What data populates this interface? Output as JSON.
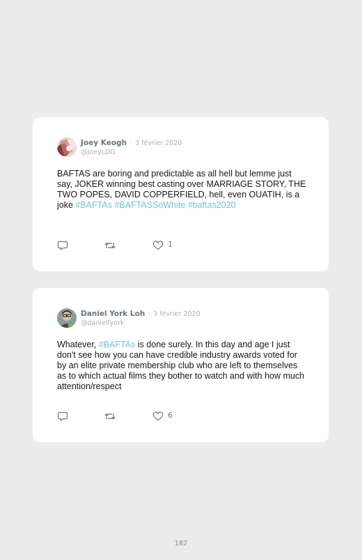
{
  "tweets": [
    {
      "name": "Joey Keogh",
      "separator": "·",
      "date": "3 février 2020",
      "handle": "@JoeyLDG",
      "text_parts": [
        {
          "text": "BAFTAS are boring and predictable as all hell but lemme just say, JOKER winning best casting over MARRIAGE STORY, THE TWO POPES, DAVID COPPERFIELD, hell, even OUATIH, is a joke "
        },
        {
          "text": "#BAFTAs"
        },
        {
          "text": " "
        },
        {
          "text": "#BAFTASSoWhite"
        },
        {
          "text": " "
        },
        {
          "text": "#baftas2020"
        }
      ],
      "likes": "1",
      "icons": [
        "reply-icon",
        "retweet-icon",
        "heart-icon"
      ]
    },
    {
      "name": "Daniel York Loh",
      "separator": "·",
      "date": "3 février 2020",
      "handle": "@danielfyork",
      "text_parts": [
        {
          "text": "Whatever, "
        },
        {
          "text": "#BAFTAs"
        },
        {
          "text": " is done surely. In this day and age I just don't see how you can have credible industry awards voted for by an elite private membership club who are left to themselves as to which actual films they bother to watch and with how much attention/respect"
        }
      ],
      "likes": "6",
      "icons": [
        "reply-icon",
        "retweet-icon",
        "heart-icon"
      ]
    }
  ],
  "page_number": "182",
  "colors": {
    "background": "#ececec",
    "card": "#ffffff",
    "hashtag": "#6ec3e6",
    "meta": "#a7b0b8",
    "name": "#657786"
  }
}
